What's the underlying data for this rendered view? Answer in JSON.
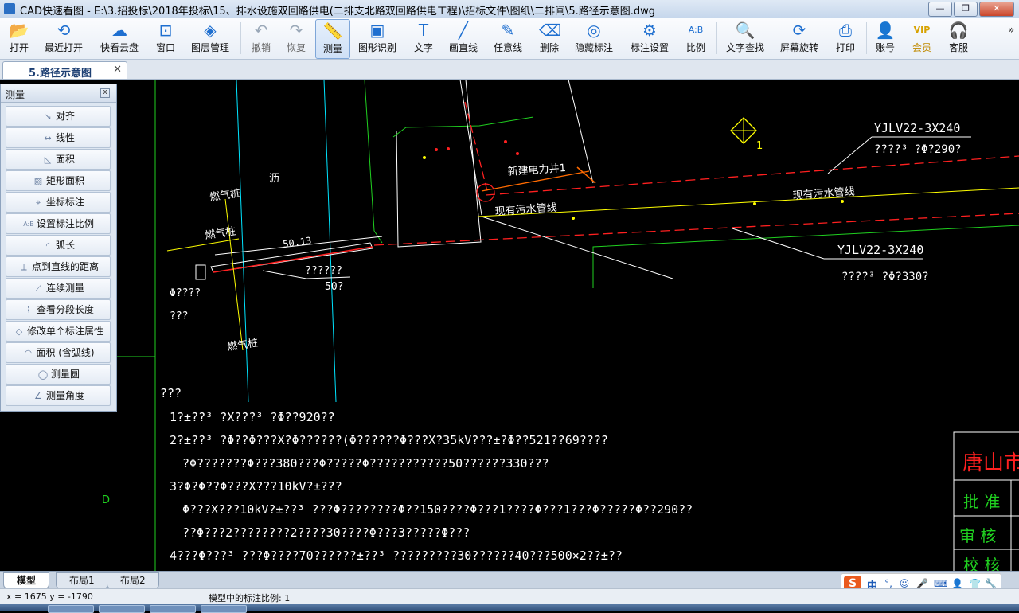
{
  "window": {
    "title": "CAD快速看图 - E:\\3.招投标\\2018年投标\\15、排水设施双回路供电(二排支北路双回路供电工程)\\招标文件\\图纸\\二排闸\\5.路径示意图.dwg",
    "minimize": "—",
    "restore": "❐",
    "close": "✕"
  },
  "toolbar": [
    {
      "label": "打开",
      "icon": "📂",
      "state": "normal"
    },
    {
      "label": "最近打开",
      "icon": "⟲",
      "state": "normal"
    },
    {
      "label": "快看云盘",
      "icon": "☁",
      "state": "normal"
    },
    {
      "label": "窗口",
      "icon": "⊡",
      "state": "normal"
    },
    {
      "label": "图层管理",
      "icon": "◈",
      "state": "normal"
    },
    {
      "label": "撤销",
      "icon": "↶",
      "state": "gray"
    },
    {
      "label": "恢复",
      "icon": "↷",
      "state": "gray"
    },
    {
      "label": "测量",
      "icon": "📏",
      "state": "active"
    },
    {
      "label": "图形识别",
      "icon": "▣",
      "state": "normal"
    },
    {
      "label": "文字",
      "icon": "T",
      "state": "normal"
    },
    {
      "label": "画直线",
      "icon": "╱",
      "state": "normal"
    },
    {
      "label": "任意线",
      "icon": "✎",
      "state": "normal"
    },
    {
      "label": "删除",
      "icon": "⌫",
      "state": "normal"
    },
    {
      "label": "隐藏标注",
      "icon": "◎",
      "state": "normal"
    },
    {
      "label": "标注设置",
      "icon": "⚙",
      "state": "normal"
    },
    {
      "label": "比例",
      "icon": "A:B",
      "state": "normal"
    },
    {
      "label": "文字查找",
      "icon": "🔍",
      "state": "normal"
    },
    {
      "label": "屏幕旋转",
      "icon": "⟳",
      "state": "normal"
    },
    {
      "label": "打印",
      "icon": "⎙",
      "state": "normal"
    },
    {
      "label": "账号",
      "icon": "👤",
      "state": "normal"
    },
    {
      "label": "会员",
      "icon": "VIP",
      "state": "vip"
    },
    {
      "label": "客服",
      "icon": "🎧",
      "state": "normal"
    },
    {
      "label": "",
      "icon": "»",
      "state": "arrow"
    }
  ],
  "doc_tab": {
    "label": "5.路径示意图",
    "close": "✕"
  },
  "measure_panel": {
    "title": "测量",
    "close": "x",
    "items": [
      {
        "label": "对齐",
        "icon": "↘"
      },
      {
        "label": "线性",
        "icon": "↔"
      },
      {
        "label": "面积",
        "icon": "◺"
      },
      {
        "label": "矩形面积",
        "icon": "▨"
      },
      {
        "label": "坐标标注",
        "icon": "⌖"
      },
      {
        "label": "设置标注比例",
        "icon": "A:B"
      },
      {
        "label": "弧长",
        "icon": "◜"
      },
      {
        "label": "点到直线的距离",
        "icon": "⟂"
      },
      {
        "label": "连续测量",
        "icon": "⟋"
      },
      {
        "label": "查看分段长度",
        "icon": "⌇"
      },
      {
        "label": "修改单个标注属性",
        "icon": "◇"
      },
      {
        "label": "面积 (含弧线)",
        "icon": "◠"
      },
      {
        "label": "测量圆",
        "icon": "◯"
      },
      {
        "label": "测量角度",
        "icon": "∠"
      }
    ]
  },
  "drawing": {
    "labels": {
      "gas1": "燃气桩",
      "gas2": "燃气桩",
      "gas3": "燃气桩",
      "li": "沥",
      "dim": "50.13",
      "dim2": "??????",
      "dim3": "50?",
      "phi1": "Φ????",
      "q3": "???",
      "well": "新建电力井1",
      "sewer1": "现有污水管线",
      "sewer2": "现有污水管线",
      "cable1": "YJLV22-3X240",
      "cable1b": "????³ ?Φ?290?",
      "cable2": "YJLV22-3X240",
      "cable2b": "????³ ?Φ?330?",
      "one": "1",
      "d": "D"
    },
    "notes": [
      "???",
      "1?±??³ ?X???³ ?Φ??920??",
      "2?±??³ ?Φ??Φ???X?Φ??????(Φ??????Φ???X?35kV???±?Φ??521??69????",
      "?Φ???????Φ???380???Φ?????Φ???????????50??????330???",
      "3?Φ?Φ??Φ???X???10kV?±???",
      "Φ???X???10kV?±??³ ???Φ????????Φ??150????Φ???1????Φ???1???Φ?????Φ??290??",
      "??Φ???2????????2????30????Φ???3?????Φ???",
      "4???Φ???³ ???Φ????70??????±??³ ?????????30??????40???500×2??±??"
    ],
    "title_block": {
      "name": "唐山市新",
      "approve": "批  准",
      "review": "审  核",
      "check": "校  核"
    }
  },
  "layout_tabs": [
    "模型",
    "布局1",
    "布局2"
  ],
  "ime": {
    "logo": "S",
    "lang": "中",
    "punct": "°,",
    "emoji": "☺",
    "mic": "🎤",
    "kbd": "⌨",
    "user": "👤",
    "shirt": "👕",
    "tool": "🔧"
  },
  "status": {
    "coords": "x = 1675  y = -1790",
    "scale": "模型中的标注比例: 1"
  },
  "colors": {
    "accent": "#1e6fd0",
    "canvas": "#000000",
    "yellow": "#ffff00",
    "red": "#ff2020",
    "cyan": "#00e5ff",
    "green": "#20d020",
    "white": "#ffffff"
  }
}
